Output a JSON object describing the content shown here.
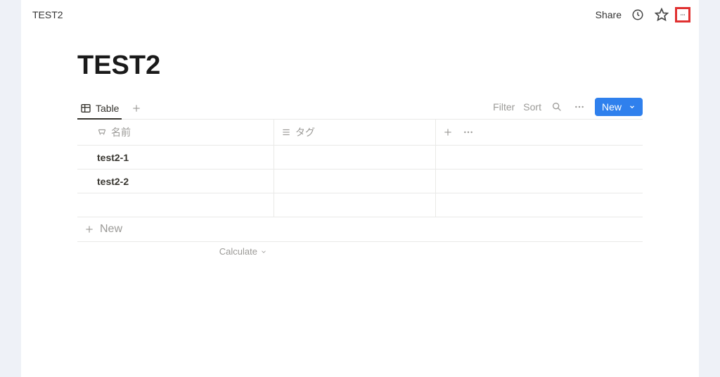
{
  "breadcrumb": "TEST2",
  "topbar": {
    "share": "Share"
  },
  "page": {
    "title": "TEST2"
  },
  "view": {
    "tab_label": "Table",
    "filter": "Filter",
    "sort": "Sort",
    "new": "New"
  },
  "columns": {
    "name": "名前",
    "tags": "タグ"
  },
  "rows": [
    {
      "name": "test2-1"
    },
    {
      "name": "test2-2"
    }
  ],
  "footer": {
    "new_row": "New",
    "calculate": "Calculate"
  }
}
